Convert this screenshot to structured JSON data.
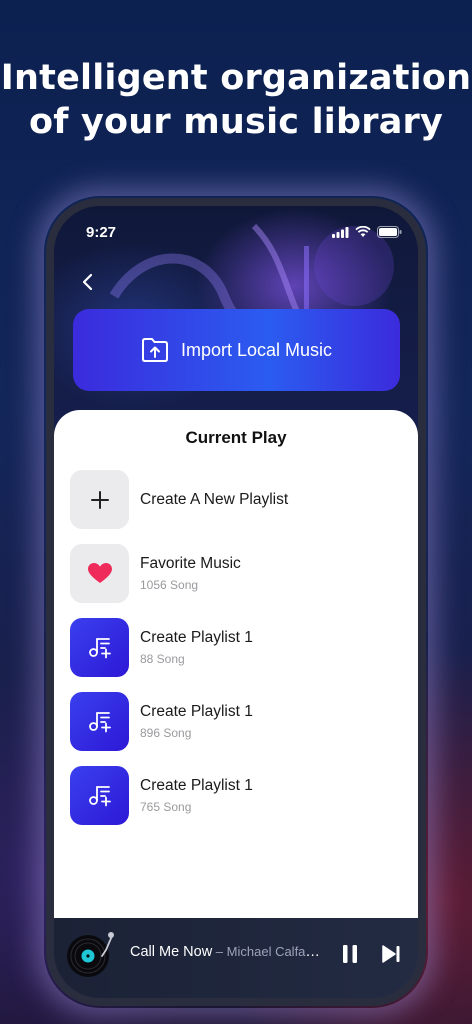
{
  "headline": {
    "line1": "Intelligent organization",
    "line2": "of your music library"
  },
  "status_bar": {
    "time": "9:27",
    "icons": [
      "signal-icon",
      "wifi-icon",
      "battery-icon"
    ]
  },
  "nav": {
    "back_icon": "chevron-left-icon"
  },
  "import_button": {
    "label": "Import Local Music",
    "icon": "folder-upload-icon"
  },
  "sheet": {
    "title": "Current Play",
    "items": [
      {
        "title": "Create A New Playlist",
        "subtitle": "",
        "icon": "plus-icon"
      },
      {
        "title": "Favorite Music",
        "subtitle": "1056 Song",
        "icon": "heart-icon"
      },
      {
        "title": "Create Playlist 1",
        "subtitle": "88 Song",
        "icon": "playlist-add-icon"
      },
      {
        "title": "Create Playlist 1",
        "subtitle": "896 Song",
        "icon": "playlist-add-icon"
      },
      {
        "title": "Create Playlist 1",
        "subtitle": "765 Song",
        "icon": "playlist-add-icon"
      }
    ]
  },
  "player": {
    "track": "Call Me Now",
    "separator": " – ",
    "artist": "Michael Calfan/...",
    "controls": [
      "pause-icon",
      "skip-next-icon"
    ]
  },
  "colors": {
    "accent_blue": "#2d4df0",
    "accent_violet": "#3b2bdc",
    "heart": "#ee2b5a",
    "player_bg": "#1e2539"
  }
}
